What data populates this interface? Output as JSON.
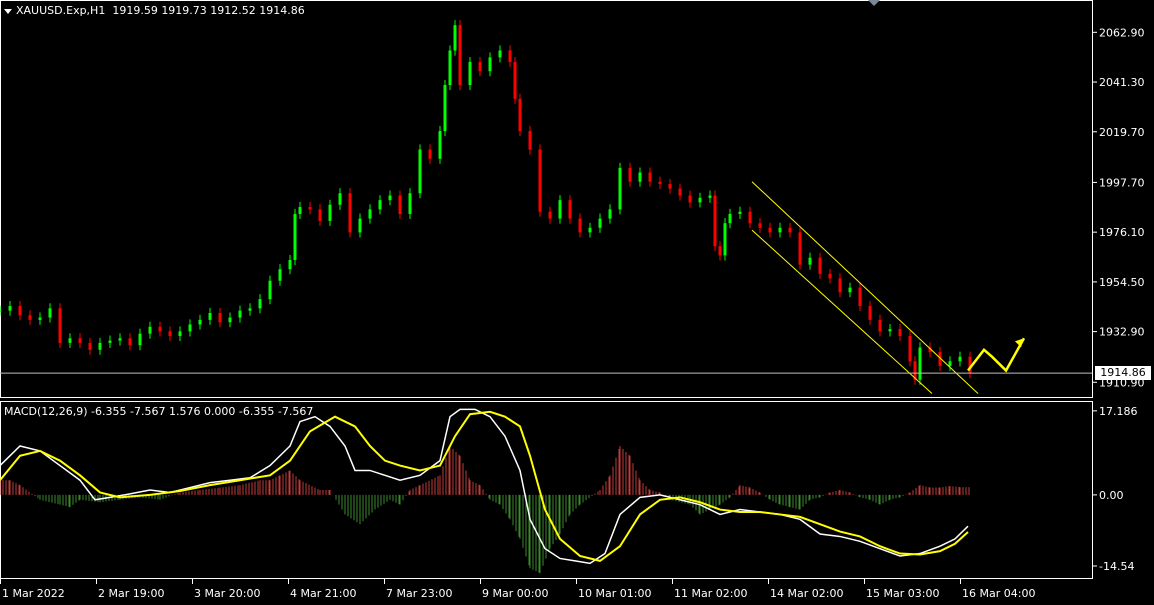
{
  "header": {
    "symbol": "XAUUSD.Exp,H1",
    "ohlc": "1919.59 1919.73 1912.52 1914.86"
  },
  "macd_header": {
    "text": "MACD(12,26,9) -6.355 -7.567 1.576 0.000 -6.355 -7.567"
  },
  "price_label": "1914.86",
  "colors": {
    "background": "#000000",
    "grid": "#ffffff",
    "bull": "#00ff00",
    "bear": "#ff0000",
    "macd_line": "#ffffff",
    "signal_line": "#ffff00",
    "histo_pos": "#c43a3a",
    "histo_neg": "#3a8a2a",
    "channel": "#ffff00",
    "arrow": "#ffff00"
  },
  "icons": [
    "dropdown-triangle-icon",
    "scroll-marker-icon",
    "forecast-arrow-icon"
  ],
  "chart_data": [
    {
      "type": "candlestick",
      "title": "XAUUSD.Exp,H1",
      "y_ticks": [
        "2062.90",
        "2041.30",
        "2019.70",
        "1997.70",
        "1976.10",
        "1954.50",
        "1932.90",
        "1910.90"
      ],
      "y_tick_values": [
        2062.9,
        2041.3,
        2019.7,
        1997.7,
        1976.1,
        1954.5,
        1932.9,
        1910.9
      ],
      "ylim": [
        1904.5,
        2076.5
      ],
      "x_ticks": [
        "1 Mar 2022",
        "2 Mar 19:00",
        "3 Mar 20:00",
        "4 Mar 21:00",
        "7 Mar 23:00",
        "9 Mar 00:00",
        "10 Mar 01:00",
        "11 Mar 02:00",
        "14 Mar 02:00",
        "15 Mar 03:00",
        "16 Mar 04:00"
      ],
      "last_price": 1914.86,
      "close_path": [
        [
          0,
          1942
        ],
        [
          10,
          1944
        ],
        [
          20,
          1940
        ],
        [
          30,
          1938
        ],
        [
          40,
          1939
        ],
        [
          50,
          1943
        ],
        [
          60,
          1928
        ],
        [
          70,
          1930
        ],
        [
          80,
          1928
        ],
        [
          90,
          1925
        ],
        [
          100,
          1928
        ],
        [
          110,
          1929
        ],
        [
          120,
          1930
        ],
        [
          130,
          1927
        ],
        [
          140,
          1932
        ],
        [
          150,
          1935
        ],
        [
          160,
          1933
        ],
        [
          170,
          1931
        ],
        [
          180,
          1933
        ],
        [
          190,
          1936
        ],
        [
          200,
          1938
        ],
        [
          210,
          1941
        ],
        [
          220,
          1937
        ],
        [
          230,
          1939
        ],
        [
          240,
          1942
        ],
        [
          250,
          1943
        ],
        [
          260,
          1947
        ],
        [
          270,
          1955
        ],
        [
          280,
          1960
        ],
        [
          290,
          1964
        ],
        [
          295,
          1984
        ],
        [
          300,
          1987
        ],
        [
          310,
          1986
        ],
        [
          320,
          1981
        ],
        [
          330,
          1988
        ],
        [
          340,
          1993
        ],
        [
          350,
          1976
        ],
        [
          360,
          1982
        ],
        [
          370,
          1986
        ],
        [
          380,
          1990
        ],
        [
          390,
          1992
        ],
        [
          400,
          1984
        ],
        [
          410,
          1993
        ],
        [
          420,
          2012
        ],
        [
          430,
          2008
        ],
        [
          440,
          2020
        ],
        [
          445,
          2040
        ],
        [
          450,
          2055
        ],
        [
          455,
          2066
        ],
        [
          460,
          2040
        ],
        [
          470,
          2050
        ],
        [
          480,
          2046
        ],
        [
          490,
          2052
        ],
        [
          500,
          2055
        ],
        [
          510,
          2050
        ],
        [
          515,
          2034
        ],
        [
          520,
          2020
        ],
        [
          530,
          2012
        ],
        [
          540,
          1985
        ],
        [
          550,
          1982
        ],
        [
          560,
          1990
        ],
        [
          570,
          1982
        ],
        [
          580,
          1976
        ],
        [
          590,
          1978
        ],
        [
          600,
          1982
        ],
        [
          610,
          1986
        ],
        [
          620,
          2004
        ],
        [
          630,
          1998
        ],
        [
          640,
          2002
        ],
        [
          650,
          1998
        ],
        [
          660,
          1997
        ],
        [
          670,
          1995
        ],
        [
          680,
          1992
        ],
        [
          690,
          1989
        ],
        [
          700,
          1991
        ],
        [
          710,
          1992
        ],
        [
          715,
          1970
        ],
        [
          720,
          1966
        ],
        [
          725,
          1980
        ],
        [
          730,
          1984
        ],
        [
          740,
          1985
        ],
        [
          750,
          1980
        ],
        [
          760,
          1978
        ],
        [
          770,
          1976
        ],
        [
          780,
          1978
        ],
        [
          790,
          1976
        ],
        [
          800,
          1962
        ],
        [
          810,
          1965
        ],
        [
          820,
          1958
        ],
        [
          830,
          1956
        ],
        [
          840,
          1950
        ],
        [
          850,
          1952
        ],
        [
          860,
          1944
        ],
        [
          870,
          1938
        ],
        [
          880,
          1933
        ],
        [
          890,
          1934
        ],
        [
          900,
          1931
        ],
        [
          910,
          1920
        ],
        [
          915,
          1912
        ],
        [
          920,
          1926
        ],
        [
          930,
          1924
        ],
        [
          940,
          1918
        ],
        [
          950,
          1920
        ],
        [
          960,
          1922
        ],
        [
          970,
          1914.86
        ]
      ],
      "channel_upper": [
        [
          752,
          1998
        ],
        [
          978,
          1906
        ]
      ],
      "channel_lower": [
        [
          752,
          1977
        ],
        [
          932,
          1906
        ]
      ],
      "forecast_path": [
        [
          968,
          1916
        ],
        [
          984,
          1925
        ],
        [
          992,
          1922
        ],
        [
          1006,
          1916
        ],
        [
          1024,
          1930
        ]
      ]
    },
    {
      "type": "line",
      "title": "MACD(12,26,9)",
      "values_text": "-6.355 -7.567 1.576 0.000 -6.355 -7.567",
      "y_ticks": [
        "17.186",
        "0.00",
        "-14.54"
      ],
      "y_tick_values": [
        17.186,
        0.0,
        -14.54
      ],
      "ylim": [
        -17.0,
        19.0
      ],
      "series": [
        {
          "name": "",
          "color": "#ffffff",
          "points": [
            [
              0,
              6
            ],
            [
              20,
              10
            ],
            [
              40,
              9
            ],
            [
              60,
              6
            ],
            [
              80,
              3
            ],
            [
              95,
              -1
            ],
            [
              110,
              -0.5
            ],
            [
              130,
              0.2
            ],
            [
              150,
              1
            ],
            [
              170,
              0.5
            ],
            [
              190,
              1.5
            ],
            [
              210,
              2.5
            ],
            [
              230,
              3
            ],
            [
              250,
              3.5
            ],
            [
              270,
              6
            ],
            [
              290,
              10
            ],
            [
              300,
              15
            ],
            [
              315,
              16
            ],
            [
              330,
              14
            ],
            [
              345,
              10
            ],
            [
              355,
              5
            ],
            [
              370,
              5
            ],
            [
              385,
              4
            ],
            [
              400,
              3
            ],
            [
              420,
              4
            ],
            [
              440,
              7
            ],
            [
              450,
              16
            ],
            [
              460,
              17.5
            ],
            [
              475,
              17.5
            ],
            [
              490,
              16
            ],
            [
              505,
              12
            ],
            [
              520,
              5
            ],
            [
              530,
              -5
            ],
            [
              545,
              -11
            ],
            [
              560,
              -13
            ],
            [
              575,
              -13.5
            ],
            [
              590,
              -14
            ],
            [
              605,
              -12
            ],
            [
              620,
              -4
            ],
            [
              640,
              -0.5
            ],
            [
              660,
              0
            ],
            [
              680,
              -1
            ],
            [
              700,
              -2
            ],
            [
              720,
              -4
            ],
            [
              740,
              -3
            ],
            [
              760,
              -3.5
            ],
            [
              780,
              -4
            ],
            [
              800,
              -5
            ],
            [
              820,
              -8
            ],
            [
              840,
              -8.5
            ],
            [
              860,
              -9.5
            ],
            [
              880,
              -11
            ],
            [
              900,
              -12.5
            ],
            [
              920,
              -12
            ],
            [
              940,
              -10.5
            ],
            [
              955,
              -9
            ],
            [
              968,
              -6.4
            ]
          ]
        },
        {
          "name": "",
          "color": "#ffff00",
          "points": [
            [
              0,
              3
            ],
            [
              20,
              8
            ],
            [
              40,
              9
            ],
            [
              60,
              7
            ],
            [
              80,
              4
            ],
            [
              100,
              0.5
            ],
            [
              120,
              -0.5
            ],
            [
              150,
              0
            ],
            [
              180,
              0.8
            ],
            [
              210,
              2
            ],
            [
              240,
              3
            ],
            [
              270,
              4
            ],
            [
              290,
              7
            ],
            [
              310,
              13
            ],
            [
              335,
              16
            ],
            [
              355,
              14
            ],
            [
              370,
              10
            ],
            [
              385,
              7
            ],
            [
              400,
              6
            ],
            [
              420,
              5
            ],
            [
              440,
              6
            ],
            [
              455,
              12
            ],
            [
              470,
              16.5
            ],
            [
              490,
              17
            ],
            [
              505,
              16
            ],
            [
              520,
              14
            ],
            [
              530,
              8
            ],
            [
              545,
              -3
            ],
            [
              560,
              -9
            ],
            [
              580,
              -12.5
            ],
            [
              600,
              -13.5
            ],
            [
              620,
              -10.5
            ],
            [
              640,
              -4
            ],
            [
              660,
              -1
            ],
            [
              680,
              -0.5
            ],
            [
              700,
              -1.5
            ],
            [
              720,
              -3
            ],
            [
              740,
              -3.5
            ],
            [
              760,
              -3.5
            ],
            [
              780,
              -4
            ],
            [
              800,
              -4.5
            ],
            [
              820,
              -6
            ],
            [
              840,
              -7.5
            ],
            [
              860,
              -8.5
            ],
            [
              880,
              -10.5
            ],
            [
              900,
              -12
            ],
            [
              920,
              -12.2
            ],
            [
              940,
              -11.5
            ],
            [
              955,
              -10
            ],
            [
              968,
              -7.6
            ]
          ]
        }
      ],
      "histogram": [
        [
          0,
          3
        ],
        [
          10,
          3
        ],
        [
          20,
          2
        ],
        [
          40,
          -1
        ],
        [
          60,
          -2
        ],
        [
          70,
          -2.5
        ],
        [
          80,
          -1
        ],
        [
          100,
          -1.5
        ],
        [
          120,
          -1
        ],
        [
          140,
          -0.5
        ],
        [
          160,
          -1
        ],
        [
          180,
          0.5
        ],
        [
          200,
          1
        ],
        [
          220,
          1.5
        ],
        [
          240,
          2
        ],
        [
          260,
          3
        ],
        [
          270,
          3
        ],
        [
          280,
          4
        ],
        [
          290,
          5
        ],
        [
          300,
          3
        ],
        [
          320,
          1
        ],
        [
          330,
          1
        ],
        [
          345,
          -4
        ],
        [
          360,
          -6
        ],
        [
          375,
          -3
        ],
        [
          390,
          -1
        ],
        [
          400,
          -2
        ],
        [
          410,
          1
        ],
        [
          420,
          2
        ],
        [
          440,
          4
        ],
        [
          450,
          10
        ],
        [
          460,
          8
        ],
        [
          470,
          3
        ],
        [
          480,
          2
        ],
        [
          490,
          -1
        ],
        [
          500,
          -2
        ],
        [
          510,
          -5
        ],
        [
          520,
          -9
        ],
        [
          530,
          -15
        ],
        [
          540,
          -16
        ],
        [
          550,
          -11
        ],
        [
          560,
          -8
        ],
        [
          570,
          -4
        ],
        [
          580,
          -2
        ],
        [
          600,
          1
        ],
        [
          610,
          4
        ],
        [
          620,
          10
        ],
        [
          630,
          8
        ],
        [
          640,
          3
        ],
        [
          650,
          1
        ],
        [
          660,
          0.5
        ],
        [
          670,
          -1
        ],
        [
          690,
          -2
        ],
        [
          700,
          -4
        ],
        [
          710,
          -3
        ],
        [
          720,
          -2
        ],
        [
          730,
          -0.5
        ],
        [
          740,
          2
        ],
        [
          750,
          1.5
        ],
        [
          760,
          0.5
        ],
        [
          770,
          -1
        ],
        [
          780,
          -2
        ],
        [
          790,
          -2.5
        ],
        [
          800,
          -3
        ],
        [
          810,
          -1
        ],
        [
          820,
          -0.5
        ],
        [
          830,
          0.5
        ],
        [
          840,
          1
        ],
        [
          850,
          0.5
        ],
        [
          860,
          -0.5
        ],
        [
          870,
          -1
        ],
        [
          880,
          -2
        ],
        [
          890,
          -1
        ],
        [
          900,
          -0.5
        ],
        [
          910,
          0.5
        ],
        [
          920,
          2
        ],
        [
          930,
          1.5
        ],
        [
          940,
          1.5
        ],
        [
          950,
          1.8
        ],
        [
          960,
          1.6
        ],
        [
          970,
          1.6
        ]
      ]
    }
  ]
}
